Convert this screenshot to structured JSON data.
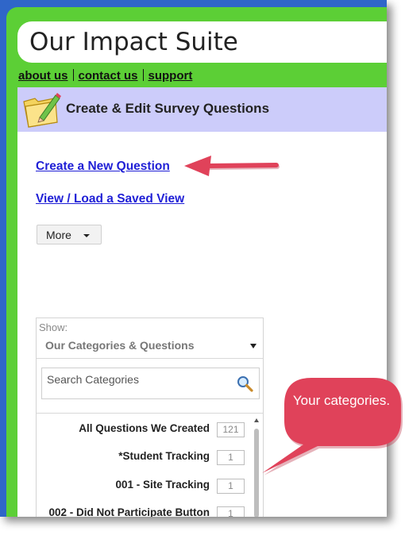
{
  "app": {
    "title": "Our Impact Suite"
  },
  "top_links": [
    {
      "label": "about us"
    },
    {
      "label": "contact us"
    },
    {
      "label": "support"
    }
  ],
  "panel": {
    "title": "Create & Edit Survey Questions",
    "icon": "folder-pencil-icon",
    "actions": [
      {
        "label": "Create a New Question"
      },
      {
        "label": "View / Load a Saved View"
      }
    ],
    "more_button": {
      "label": "More"
    }
  },
  "categories": {
    "show_label": "Show:",
    "show_value": "Our Categories & Questions",
    "search_placeholder": "Search Categories",
    "items": [
      {
        "name": "All Questions We Created",
        "count": "121"
      },
      {
        "name": "*Student Tracking",
        "count": "1"
      },
      {
        "name": "001 - Site Tracking",
        "count": "1"
      },
      {
        "name": "002 - Did Not Participate Button",
        "count": "1"
      }
    ]
  },
  "annotation": {
    "callout_text": "Your categories.",
    "arrow_color": "#e0425a",
    "callout_color": "#e0425a"
  },
  "colors": {
    "frame_blue": "#2f66c9",
    "header_green": "#5ccf36",
    "panel_header": "#ccccfa",
    "link_blue": "#1f1fd6"
  }
}
